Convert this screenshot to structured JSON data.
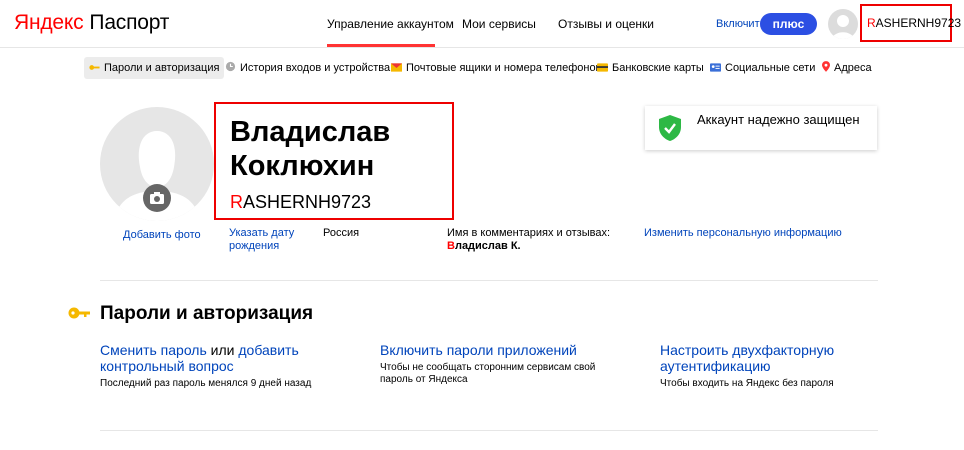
{
  "header": {
    "brand": "Яндекс",
    "product": "Паспорт",
    "tabs": [
      {
        "label": "Управление аккаунтом",
        "active": true
      },
      {
        "label": "Мои сервисы",
        "active": false
      },
      {
        "label": "Отзывы и оценки",
        "active": false
      }
    ],
    "plus_enable": "Включить",
    "plus_button": "плюс",
    "login_first": "R",
    "login_rest": "ASHERNH9723"
  },
  "subnav": [
    {
      "label": "Пароли и авторизация",
      "icon": "key-icon",
      "active": true
    },
    {
      "label": "История входов и устройства",
      "icon": "clock-icon",
      "active": false
    },
    {
      "label": "Почтовые ящики и номера телефонов",
      "icon": "mail-icon",
      "active": false
    },
    {
      "label": "Банковские карты",
      "icon": "card-icon",
      "active": false
    },
    {
      "label": "Социальные сети",
      "icon": "social-icon",
      "active": false
    },
    {
      "label": "Адреса",
      "icon": "location-pin-icon",
      "active": false
    }
  ],
  "profile": {
    "first_name": "Владислав",
    "last_name": "Коклюхин",
    "login_first": "R",
    "login_rest": "ASHERNH9723",
    "add_photo": "Добавить фото",
    "birthday_link": "Указать дату рождения",
    "country": "Россия",
    "comments_label": "Имя в комментариях и отзывах:",
    "comments_name": "Владислав К.",
    "edit_link": "Изменить персональную информацию"
  },
  "security_card": {
    "text": "Аккаунт надежно защищен"
  },
  "passwords": {
    "title": "Пароли и авторизация",
    "change_password": "Сменить пароль",
    "or": " или ",
    "add_question": "добавить контрольный вопрос",
    "change_desc": "Последний раз пароль менялся 9 дней назад",
    "app_passwords": "Включить пароли приложений",
    "app_desc": "Чтобы не сообщать сторонним сервисам свой пароль от Яндекса",
    "two_factor": "Настроить двухфакторную аутентификацию",
    "two_factor_desc": "Чтобы входить на Яндекс без пароля"
  },
  "colors": {
    "accent_red": "#ff0000",
    "link_blue": "#0044bb",
    "plus_blue": "#2c4fe3",
    "shield_green": "#2db845",
    "highlight_box": "#e00000"
  }
}
